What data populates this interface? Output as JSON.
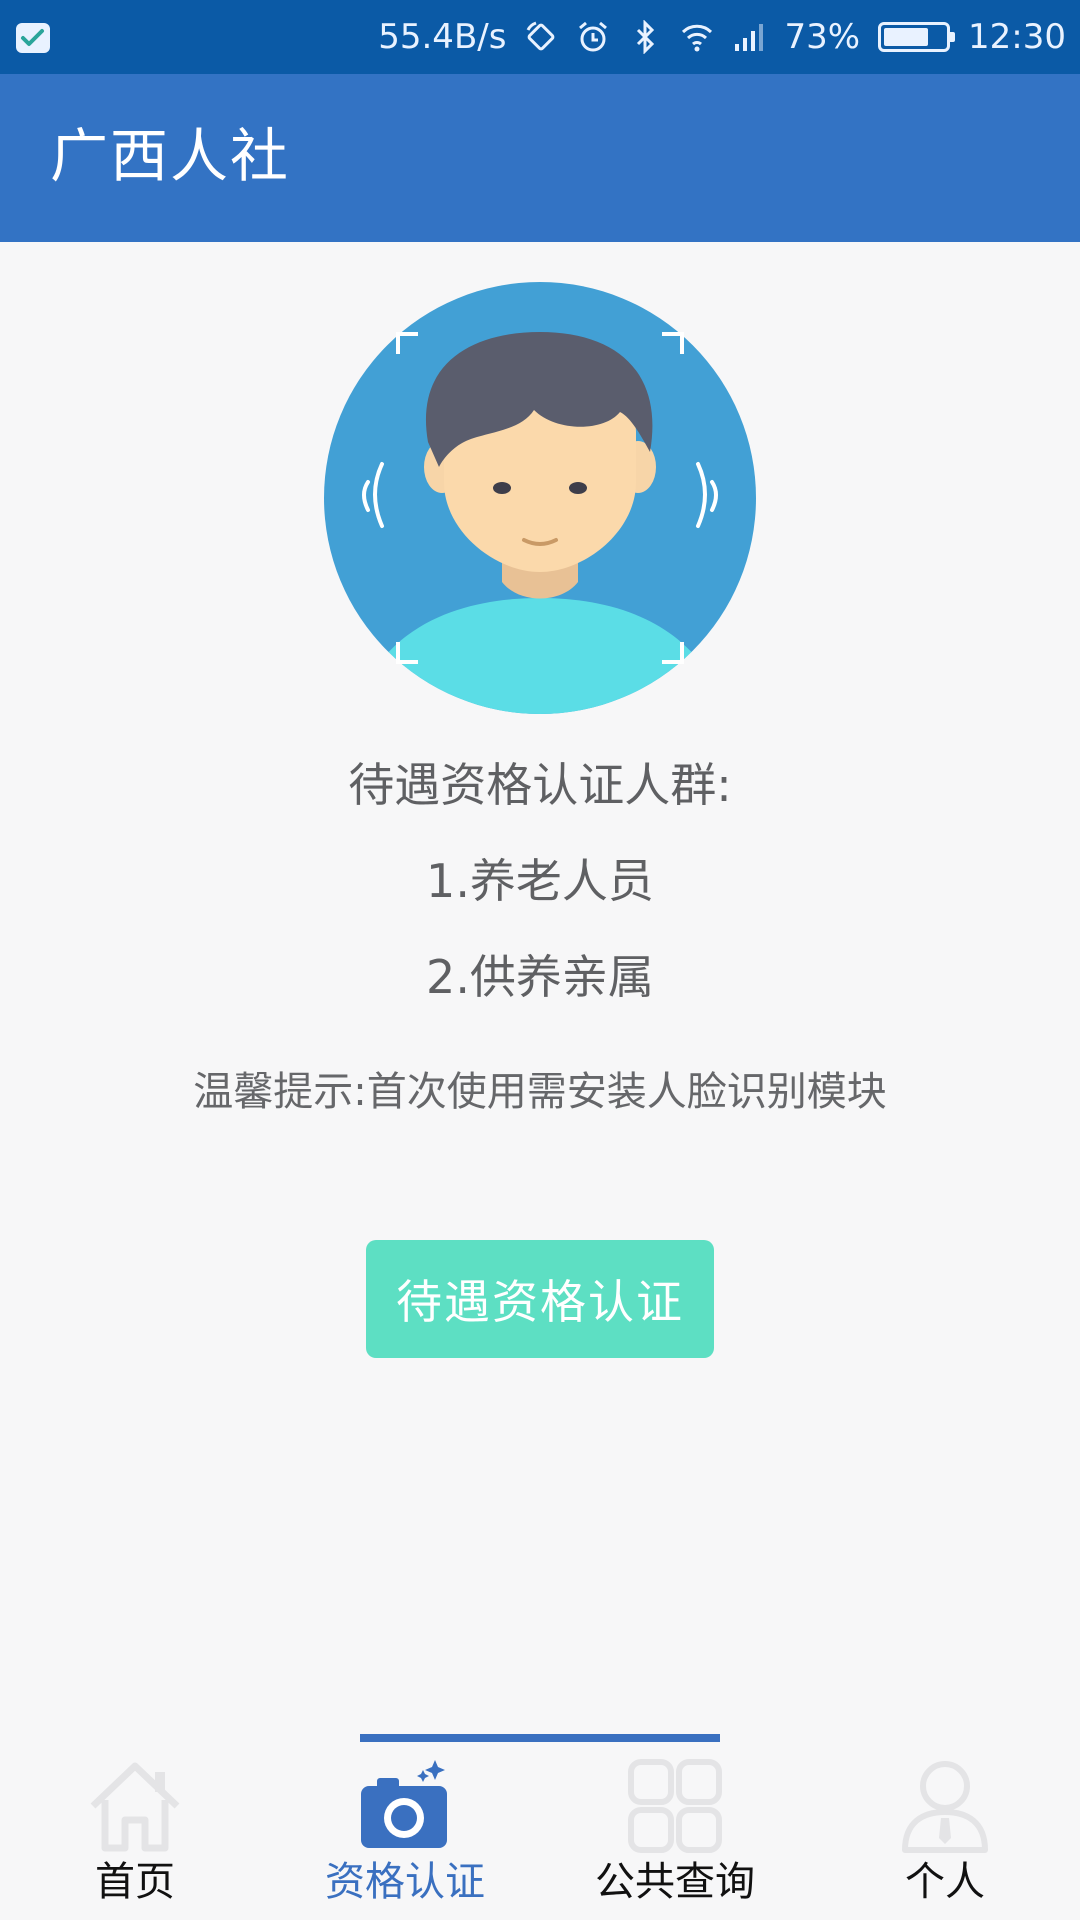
{
  "status_bar": {
    "net_speed": "55.4B/s",
    "battery_percent": "73%",
    "battery_level": 0.73,
    "time": "12:30",
    "icons": [
      "app-check-icon",
      "rotation-lock-icon",
      "alarm-icon",
      "bluetooth-icon",
      "wifi-icon",
      "signal-icon",
      "battery-icon"
    ]
  },
  "app_bar": {
    "title": "广西人社"
  },
  "main": {
    "illustration": "face-recognition-avatar",
    "group_title": "待遇资格认证人群:",
    "items": [
      "1.养老人员",
      "2.供养亲属"
    ],
    "tip": "温馨提示:首次使用需安装人脸识别模块",
    "cta_label": "待遇资格认证"
  },
  "nav": {
    "active_index": 1,
    "items": [
      {
        "label": "首页",
        "icon": "home-icon"
      },
      {
        "label": "资格认证",
        "icon": "camera-icon"
      },
      {
        "label": "公共查询",
        "icon": "grid-icon"
      },
      {
        "label": "个人",
        "icon": "person-icon"
      }
    ]
  },
  "colors": {
    "status_bar": "#0b5aa6",
    "app_bar": "#3373c4",
    "accent": "#3a70c0",
    "button": "#5ddfc3",
    "background": "#f7f7f8"
  }
}
